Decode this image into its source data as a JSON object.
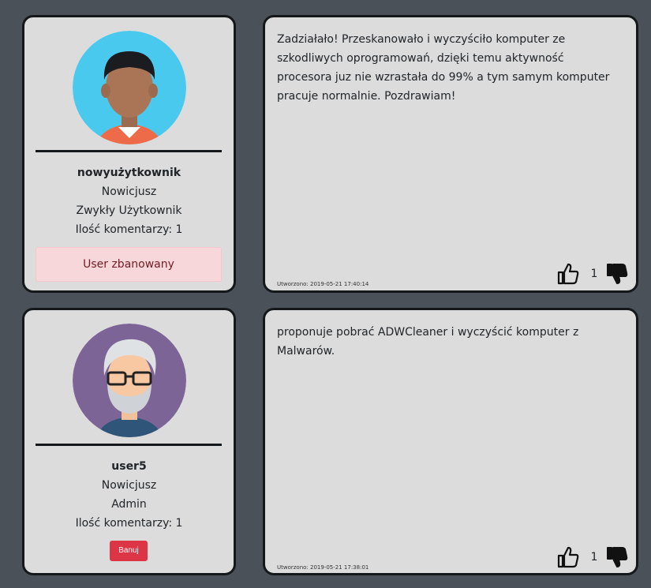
{
  "posts": [
    {
      "user": {
        "username": "nowyużytkownik",
        "rank": "Nowicjusz",
        "role": "Zwykły Użytkownik",
        "comment_count": "Ilość komentarzy: 1",
        "status_label": "User zbanowany",
        "avatar": "young-man-avatar"
      },
      "comment": {
        "text": "Zadziałało! Przeskanowało i wyczyściło komputer ze szkodliwych oprogramowań, dzięki temu aktywność procesora juz nie wzrastała do 99% a tym samym komputer pracuje normalnie. Pozdrawiam!",
        "created": "Utworzono: 2019-05-21 17:40:14",
        "votes": "1"
      }
    },
    {
      "user": {
        "username": "user5",
        "rank": "Nowicjusz",
        "role": "Admin",
        "comment_count": "Ilość komentarzy: 1",
        "ban_label": "Banuj",
        "avatar": "old-man-glasses-avatar"
      },
      "comment": {
        "text": "proponuje pobrać ADWCleaner i wyczyścić komputer z Malwarów.",
        "created": "Utworzono: 2019-05-21 17:38:01",
        "votes": "1"
      }
    }
  ],
  "icons": {
    "upvote": "thumbs-up-icon",
    "downvote": "thumbs-down-icon"
  },
  "colors": {
    "background": "#4b5158",
    "card": "#dcdcdc",
    "banned_bg": "#f8d7da",
    "ban_button": "#dc3545"
  }
}
